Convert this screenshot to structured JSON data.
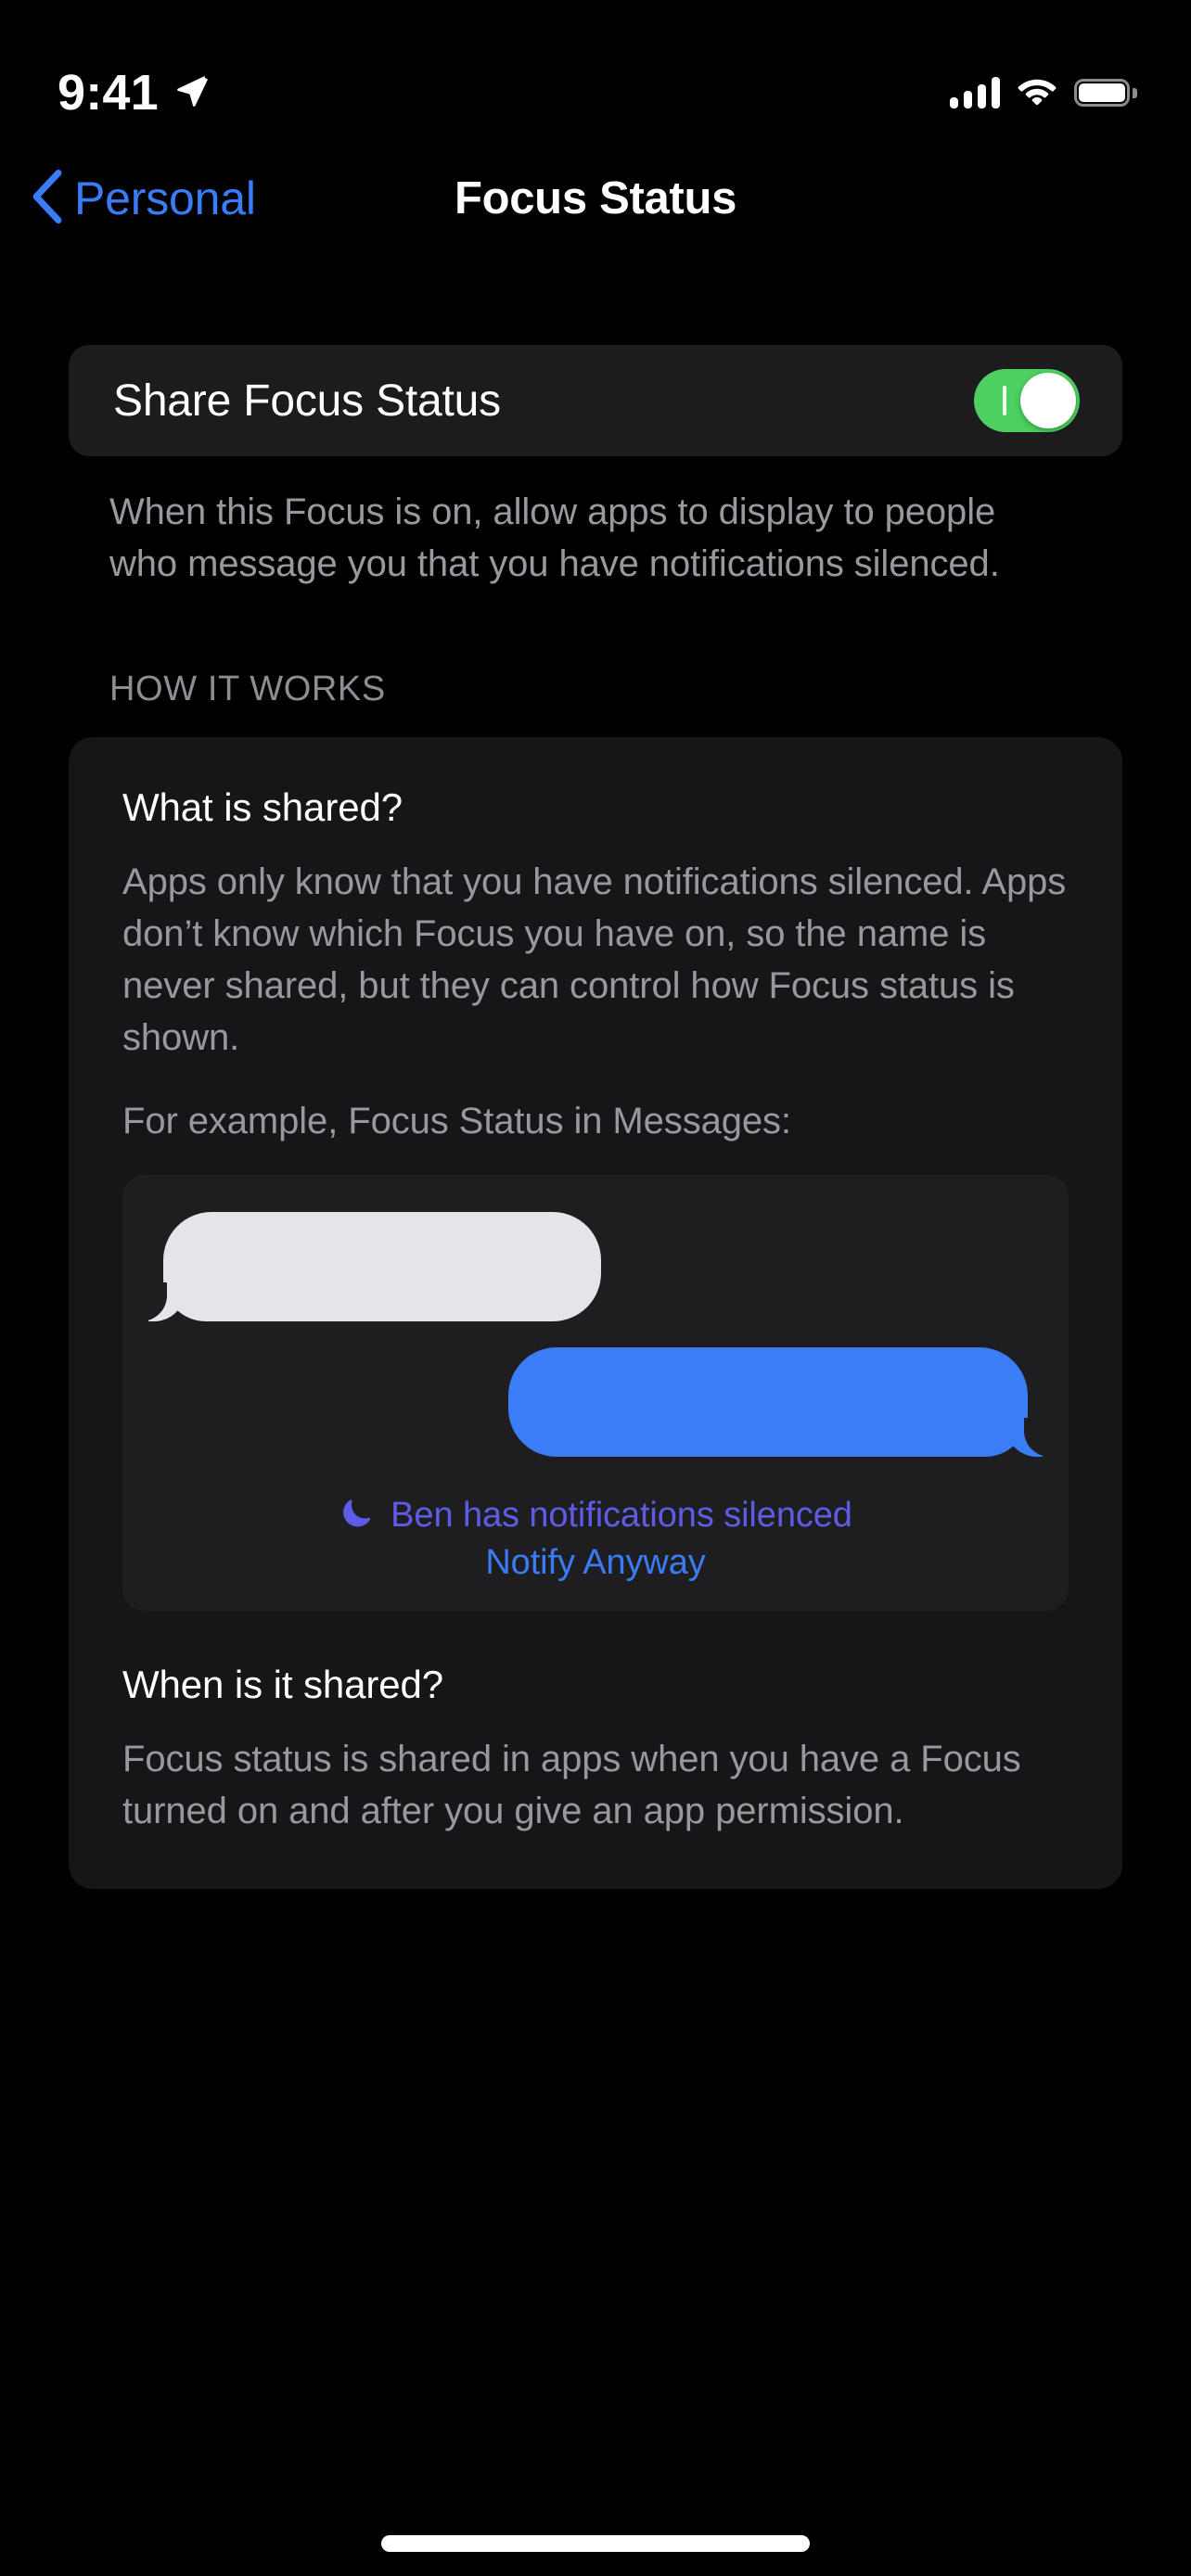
{
  "status_bar": {
    "time": "9:41",
    "location_icon": "location-arrow-icon",
    "cellular_icon": "cellular-bars-icon",
    "cellular_bars": 4,
    "wifi_icon": "wifi-icon",
    "battery_icon": "battery-full-icon"
  },
  "nav": {
    "back_label": "Personal",
    "back_icon": "chevron-left-icon",
    "title": "Focus Status"
  },
  "share_group": {
    "toggle_label": "Share Focus Status",
    "toggle_on": true,
    "footer": "When this Focus is on, allow apps to display to people who message you that you have notifications silenced."
  },
  "how_it_works": {
    "header": "HOW IT WORKS",
    "what_heading": "What is shared?",
    "what_body": "Apps only know that you have notifications silenced. Apps don’t know which Focus you have on, so the name is never shared, but they can control how Focus status is shown.",
    "example_intro": "For example, Focus Status in Messages:",
    "messages_preview": {
      "incoming_bubble": "",
      "outgoing_bubble": "",
      "moon_icon": "moon-crescent-icon",
      "silenced_text": "Ben has notifications silenced",
      "notify_anyway": "Notify Anyway"
    },
    "when_heading": "When is it shared?",
    "when_body": "Focus status is shared in apps when you have a Focus turned on and after you give an app permission."
  },
  "colors": {
    "background": "#000000",
    "group_background": "#1C1C1E",
    "card_background": "#161618",
    "preview_background": "#1E1E20",
    "accent_blue": "#3A7CF7",
    "toggle_green": "#4CD060",
    "silenced_purple": "#5E5CE6",
    "bubble_gray": "#E4E4E9",
    "bubble_blue": "#3B7DF6",
    "secondary_text": "#98989E"
  }
}
